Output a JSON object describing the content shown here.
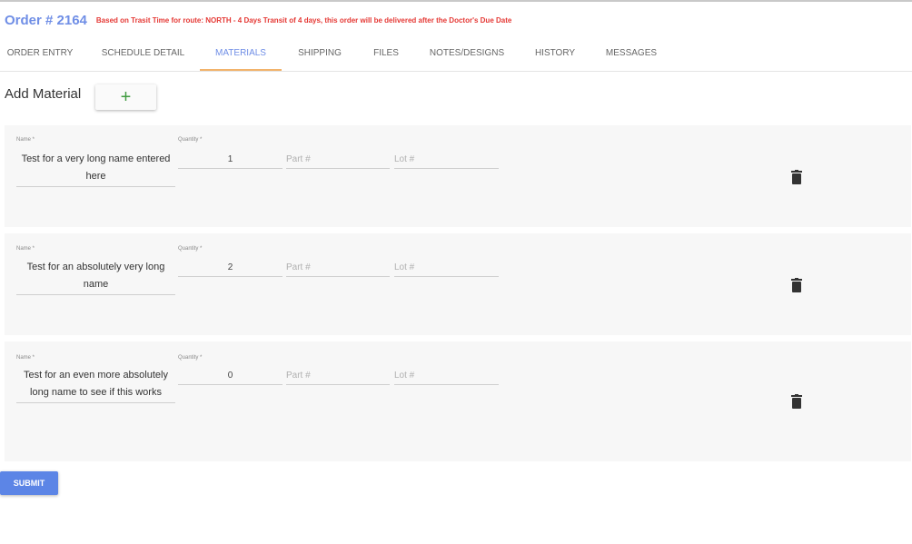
{
  "header": {
    "order_title": "Order # 2164",
    "warning": "Based on Trasit Time for route: NORTH - 4 Days Transit of 4 days, this order will be delivered after the Doctor's Due Date"
  },
  "tabs": [
    {
      "label": "ORDER ENTRY",
      "active": false
    },
    {
      "label": "SCHEDULE DETAIL",
      "active": false
    },
    {
      "label": "MATERIALS",
      "active": true
    },
    {
      "label": "SHIPPING",
      "active": false
    },
    {
      "label": "FILES",
      "active": false
    },
    {
      "label": "NOTES/DESIGNS",
      "active": false
    },
    {
      "label": "HISTORY",
      "active": false
    },
    {
      "label": "MESSAGES",
      "active": false
    }
  ],
  "add_material": {
    "label": "Add Material",
    "button_icon": "+"
  },
  "labels": {
    "name": "Name *",
    "quantity": "Quantity *",
    "part_placeholder": "Part #",
    "lot_placeholder": "Lot #"
  },
  "materials": [
    {
      "name": "Test for a very long name entered here",
      "quantity": "1",
      "part": "",
      "lot": ""
    },
    {
      "name": "Test for an absolutely very long name",
      "quantity": "2",
      "part": "",
      "lot": ""
    },
    {
      "name": "Test for an even more absolutely long name to see if this works",
      "quantity": "0",
      "part": "",
      "lot": ""
    }
  ],
  "submit_label": "SUBMIT",
  "colors": {
    "accent_blue": "#6f8ee6",
    "warning_red": "#e53935",
    "tab_underline": "#f2b36b",
    "add_green": "#3f9b3f",
    "submit_blue": "#5c85e6"
  },
  "icons": {
    "delete": "trash-icon",
    "add": "plus-icon"
  }
}
